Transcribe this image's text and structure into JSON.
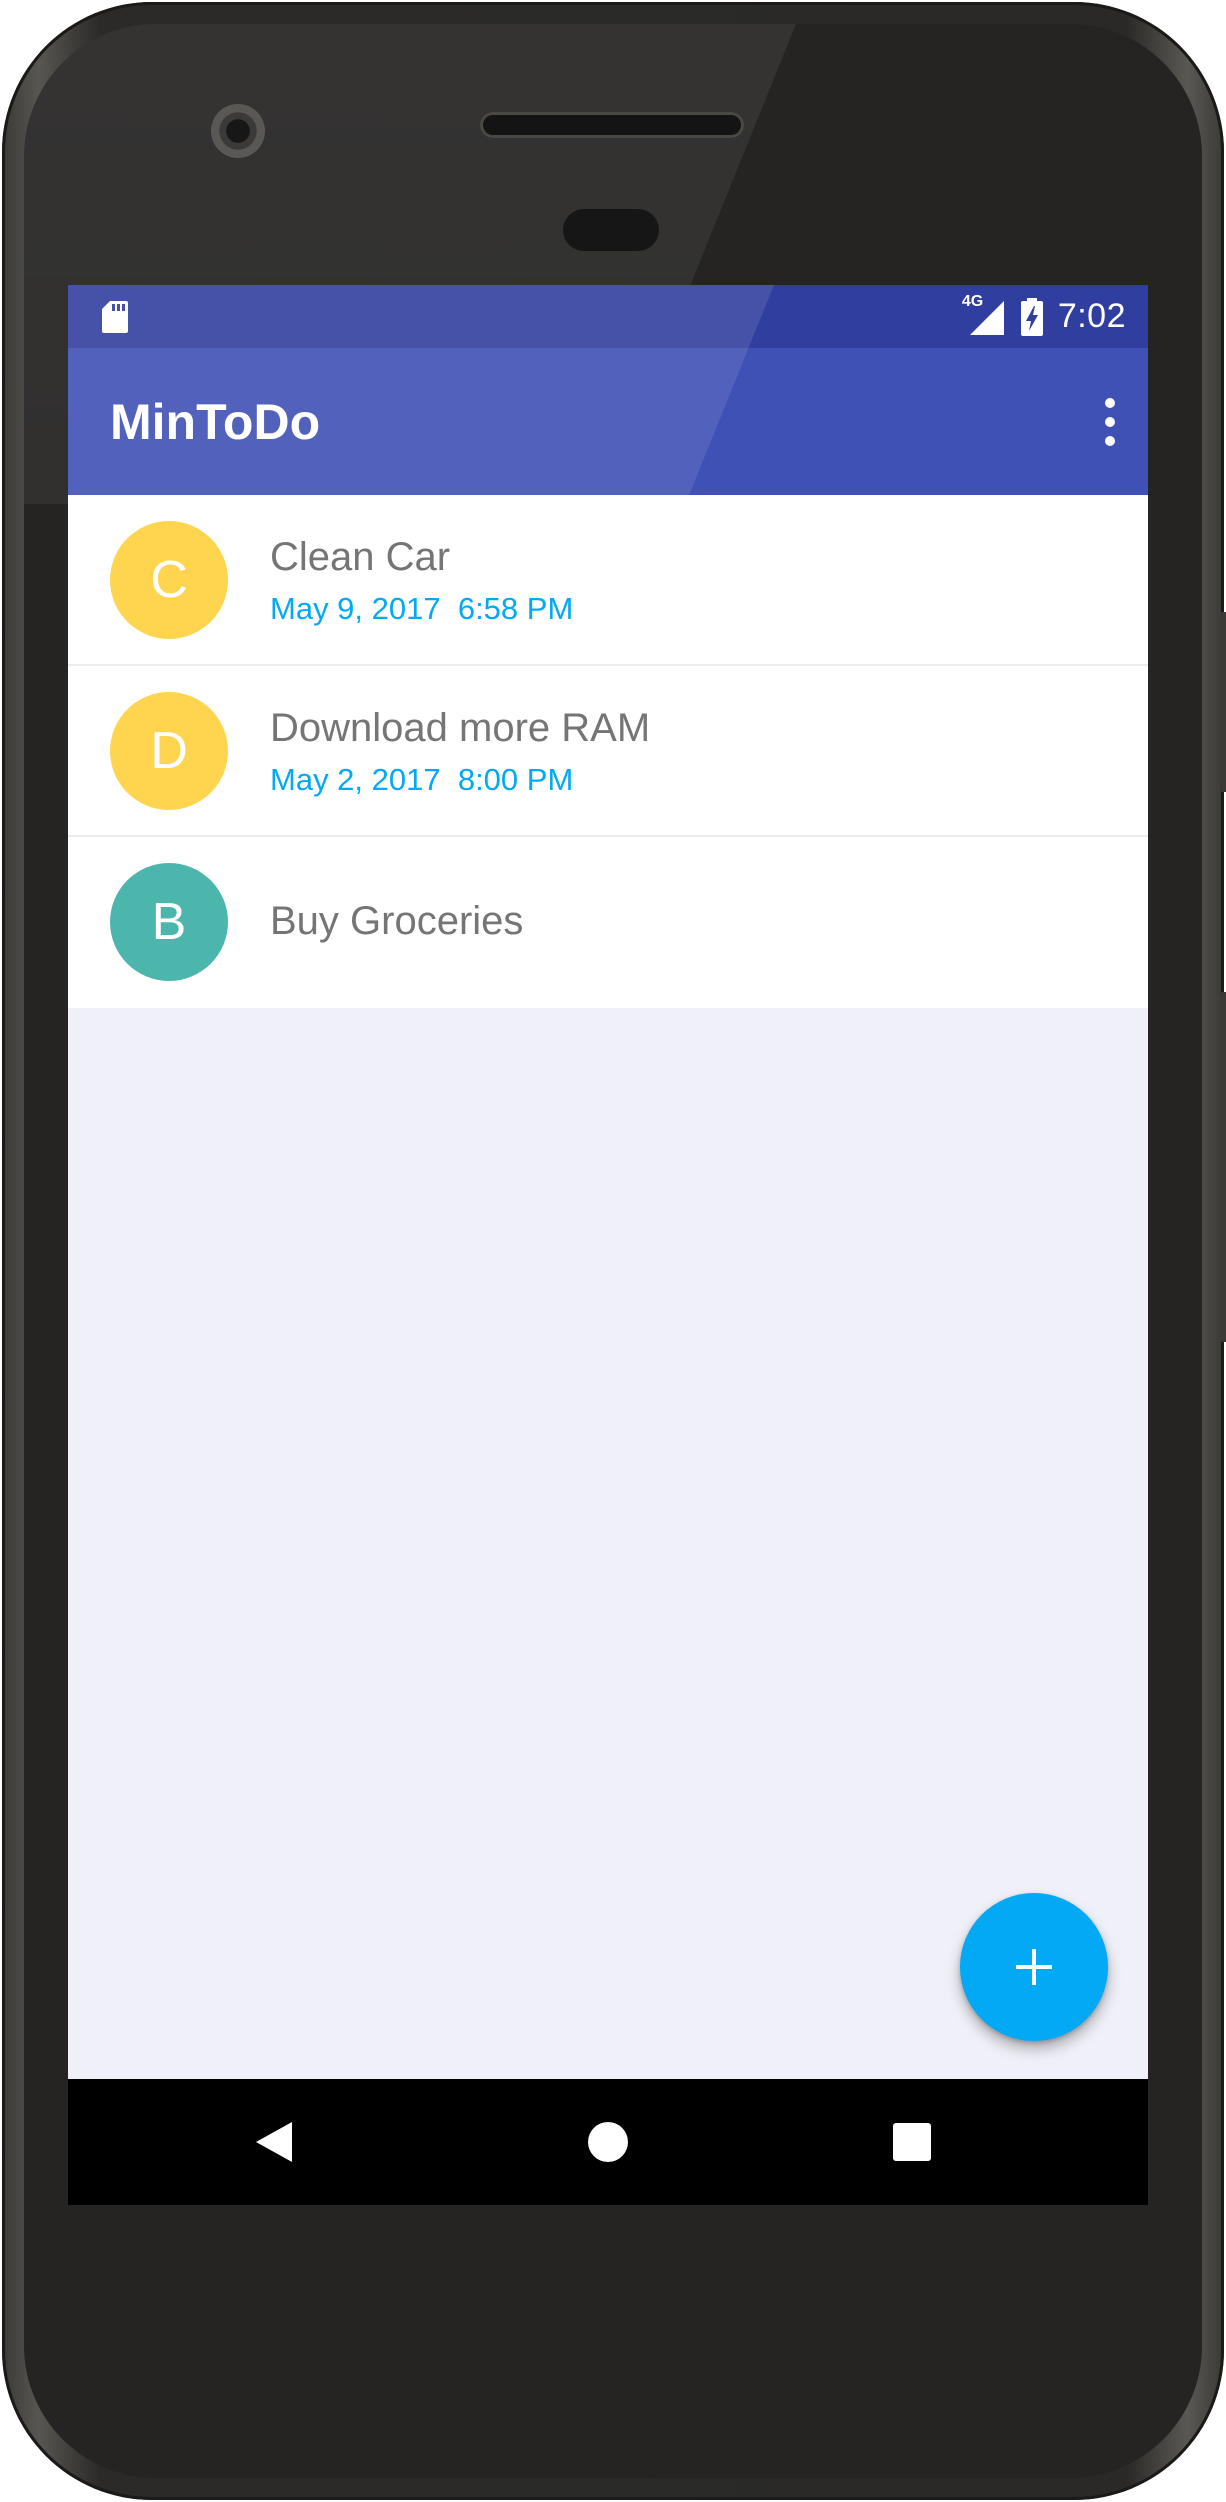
{
  "status_bar": {
    "network": "4G",
    "time": "7:02",
    "icons": [
      "sd-card-icon",
      "signal-icon",
      "battery-charging-icon"
    ]
  },
  "app_bar": {
    "title": "MinToDo",
    "overflow_icon": "more-vert-icon"
  },
  "todos": [
    {
      "initial": "C",
      "title": "Clean Car",
      "date": "May 9, 2017  6:58 PM",
      "color": "#ffd54f"
    },
    {
      "initial": "D",
      "title": "Download more RAM",
      "date": "May 2, 2017  8:00 PM",
      "color": "#ffd54f"
    },
    {
      "initial": "B",
      "title": "Buy Groceries",
      "date": "",
      "color": "#4db6ac"
    }
  ],
  "fab": {
    "icon": "add-icon",
    "color": "#03a9f4"
  },
  "nav_bar": {
    "icons": [
      "back-icon",
      "home-icon",
      "recents-icon"
    ]
  },
  "colors": {
    "primary": "#3f51b5",
    "primary_dark": "#303f9f",
    "accent": "#03a9f4",
    "background": "#eff0f8"
  }
}
